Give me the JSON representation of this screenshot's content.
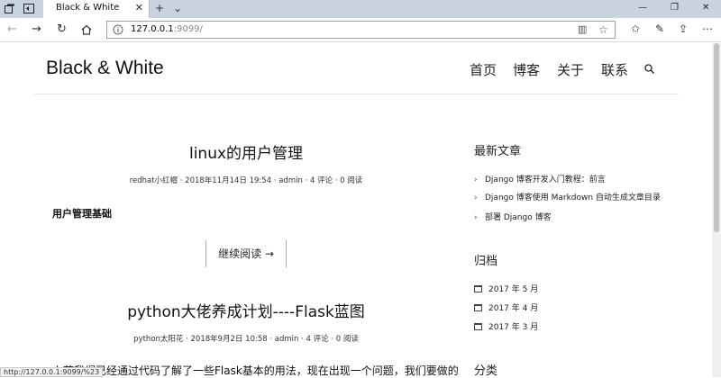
{
  "browser": {
    "tab_title": "Black & White",
    "tab_close": "✕",
    "new_tab": "+",
    "tab_menu": "⌄",
    "url_host": "127.0.0.1",
    "url_rest": ":9099/",
    "status_url": "http://127.0.0.1:9099/%23"
  },
  "site": {
    "title": "Black & White",
    "menu": [
      {
        "label": "首页"
      },
      {
        "label": "博客"
      },
      {
        "label": "关于"
      },
      {
        "label": "联系"
      }
    ]
  },
  "posts": [
    {
      "title": "linux的用户管理",
      "meta": "redhat小红帽 · 2018年11月14日 19:54 · admin · 4 评论 · 0 阅读",
      "excerpt": "用户管理基础",
      "more": "继续阅读 →"
    },
    {
      "title": "python大佬养成计划----Flask蓝图",
      "meta": "python太阳花 · 2018年9月2日 10:58 · admin · 4 评论 · 0 阅读",
      "excerpt": "上节我们已经通过代码了解了一些Flask基本的用法，现在出现一个问题，我们要做的"
    }
  ],
  "sidebar": {
    "latest_heading": "最新文章",
    "latest": [
      {
        "label": "Django 博客开发入门教程：前言"
      },
      {
        "label": "Django 博客使用 Markdown 自动生成文章目录"
      },
      {
        "label": "部署 Django 博客"
      }
    ],
    "archive_heading": "归档",
    "archive": [
      {
        "label": "2017 年 5 月"
      },
      {
        "label": "2017 年 4 月"
      },
      {
        "label": "2017 年 3 月"
      }
    ],
    "category_heading": "分类"
  }
}
